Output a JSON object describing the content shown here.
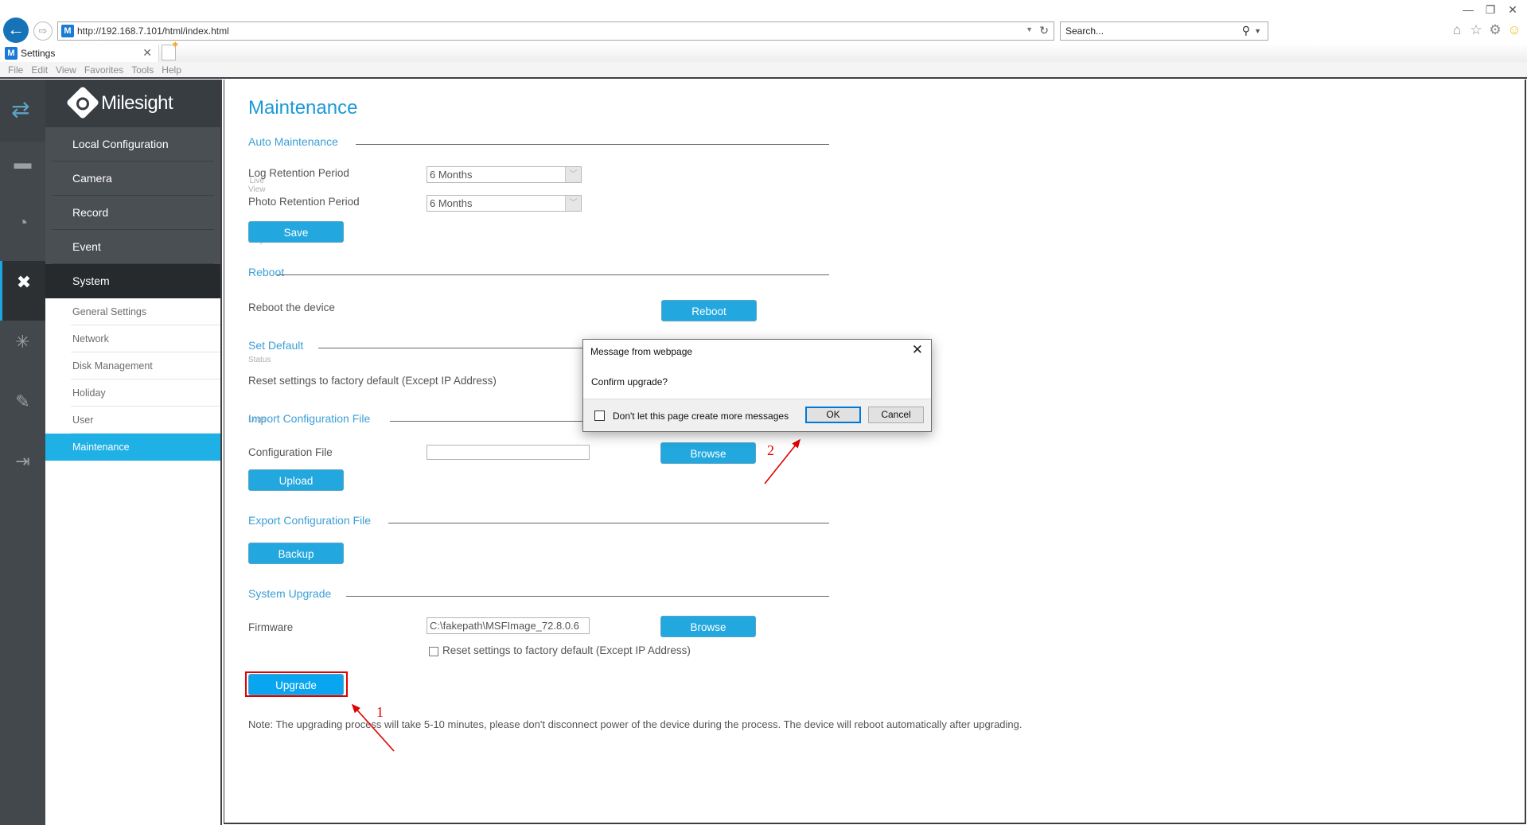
{
  "browser": {
    "window_controls": {
      "minimize": "—",
      "restore": "❐",
      "close": "✕"
    },
    "url": "http://192.168.7.101/html/index.html",
    "search_placeholder": "Search...",
    "tab_title": "Settings",
    "favicon": "M",
    "menu": [
      "File",
      "Edit",
      "View",
      "Favorites",
      "Tools",
      "Help"
    ],
    "toolbar_icons": [
      "home-icon",
      "favorites-star-icon",
      "settings-gear-icon",
      "feedback-smiley-icon"
    ]
  },
  "iconbar": {
    "items": [
      {
        "label": "Live View",
        "icon": "live-view-icon",
        "glyph": "▬"
      },
      {
        "label": "Playback",
        "icon": "playback-icon",
        "glyph": "◔"
      },
      {
        "label": "Settings",
        "icon": "settings-tools-icon",
        "glyph": "✖",
        "active": true
      },
      {
        "label": "Status",
        "icon": "status-icon",
        "glyph": "✳"
      },
      {
        "label": "Logs",
        "icon": "logs-icon",
        "glyph": "✎"
      },
      {
        "label": "Logout",
        "icon": "logout-icon",
        "glyph": "⇥"
      }
    ]
  },
  "nav": {
    "brand": "Milesight",
    "main_items": [
      "Local Configuration",
      "Camera",
      "Record",
      "Event",
      "System"
    ],
    "sub_items": [
      "General Settings",
      "Network",
      "Disk Management",
      "Holiday",
      "User",
      "Maintenance"
    ],
    "active_sub": "Maintenance"
  },
  "page": {
    "title": "Maintenance",
    "auto_maintenance": {
      "header": "Auto Maintenance",
      "log_label": "Log Retention Period",
      "log_value": "6 Months",
      "photo_label": "Photo Retention Period",
      "photo_value": "6 Months",
      "save_button": "Save"
    },
    "reboot": {
      "header": "Reboot",
      "label": "Reboot the device",
      "button": "Reboot"
    },
    "set_default": {
      "header": "Set Default",
      "label": "Reset settings to factory default (Except IP Address)"
    },
    "import_config": {
      "header": "Import Configuration File",
      "label": "Configuration File",
      "file_value": "",
      "browse_button": "Browse",
      "upload_button": "Upload"
    },
    "export_config": {
      "header": "Export Configuration File",
      "backup_button": "Backup"
    },
    "system_upgrade": {
      "header": "System Upgrade",
      "firmware_label": "Firmware",
      "firmware_value": "C:\\fakepath\\MSFImage_72.8.0.6",
      "browse_button": "Browse",
      "reset_checkbox_label": "Reset settings to factory default (Except IP Address)",
      "reset_checked": false,
      "upgrade_button": "Upgrade"
    },
    "note": "Note: The upgrading process will take 5-10 minutes, please don't disconnect power of the device during the process. The device will reboot automatically after upgrading."
  },
  "dialog": {
    "title": "Message from webpage",
    "message": "Confirm upgrade?",
    "checkbox_label": "Don't let this page create more messages",
    "ok": "OK",
    "cancel": "Cancel"
  },
  "annotations": {
    "step1": "1",
    "step2": "2",
    "color": "#e00000"
  },
  "colors": {
    "accent": "#1fb0e6",
    "button": "#22a7df",
    "section_header": "#3b9fd6",
    "sidebar_dark": "#42484c"
  }
}
